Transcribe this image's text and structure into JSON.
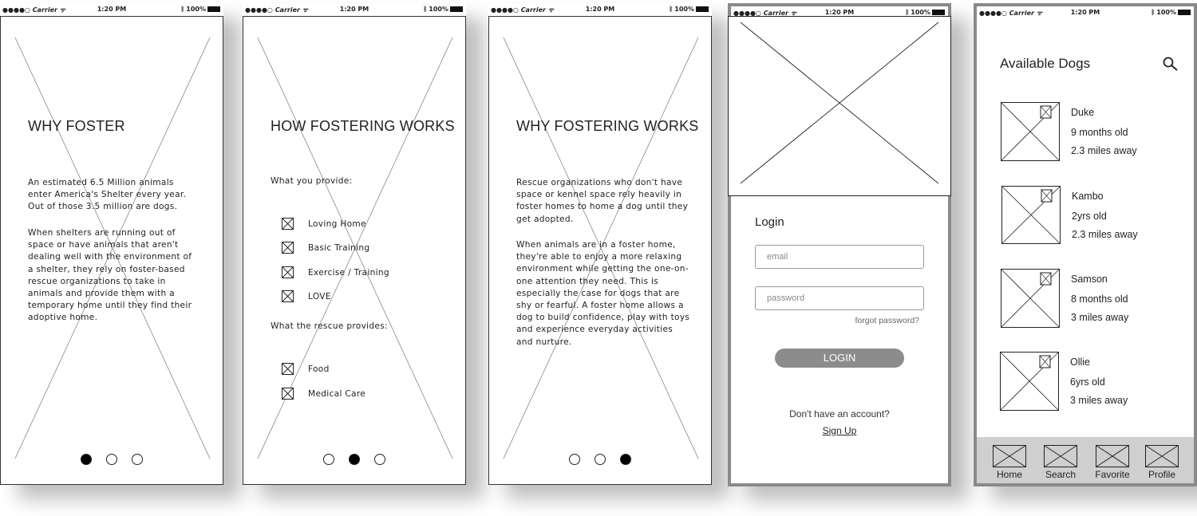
{
  "status_bar": {
    "carrier": "●●●●○ Carrier ᯤ",
    "time": "1:20 PM",
    "battery": "100%"
  },
  "screen1": {
    "title": "WHY FOSTER",
    "paragraph1": "An estimated 6.5 Million animals enter America's Shelter every year. Out of those 3.5 million are dogs.",
    "paragraph2": "When shelters are running out of space or have animals that aren't dealing well with the environment of a shelter, they rely on foster-based rescue organizations to take in animals and provide them with a temporary home until they find their adoptive home.",
    "active_dot": 1
  },
  "screen2": {
    "title": "HOW FOSTERING WORKS",
    "provide_heading": "What you provide:",
    "provide_items": [
      "Loving Home",
      "Basic Training",
      "Exercise / Training",
      "LOVE"
    ],
    "rescue_heading": "What the rescue provides:",
    "rescue_items": [
      "Food",
      "Medical Care"
    ],
    "active_dot": 2
  },
  "screen3": {
    "title": "WHY FOSTERING WORKS",
    "paragraph1": "Rescue organizations who don't have space or kennel space rely heavily in foster homes to home a dog until they get adopted.",
    "paragraph2": "When animals are in a foster home, they're able to enjoy a more relaxing environment while getting the one-on-one attention they need. This is especially the case for dogs that are shy or fearful. A foster home allows a dog to build confidence, play with toys and experience everyday activities and nurture.",
    "active_dot": 3
  },
  "login": {
    "heading": "Login",
    "email_placeholder": "email",
    "password_placeholder": "password",
    "forgot": "forgot password?",
    "button": "LOGIN",
    "no_account": "Don't have an account?",
    "signup": "Sign Up"
  },
  "dogs": {
    "title": "Available Dogs",
    "search_icon": "search-icon",
    "items": [
      {
        "name": "Duke",
        "age": "9 months old",
        "distance": "2.3 miles away"
      },
      {
        "name": "Kambo",
        "age": "2yrs old",
        "distance": "2.3 miles away"
      },
      {
        "name": "Samson",
        "age": "8 months old",
        "distance": "3 miles away"
      },
      {
        "name": "Ollie",
        "age": "6yrs old",
        "distance": "3 miles away"
      }
    ],
    "tabs": [
      "Home",
      "Search",
      "Favorite",
      "Profile"
    ]
  }
}
